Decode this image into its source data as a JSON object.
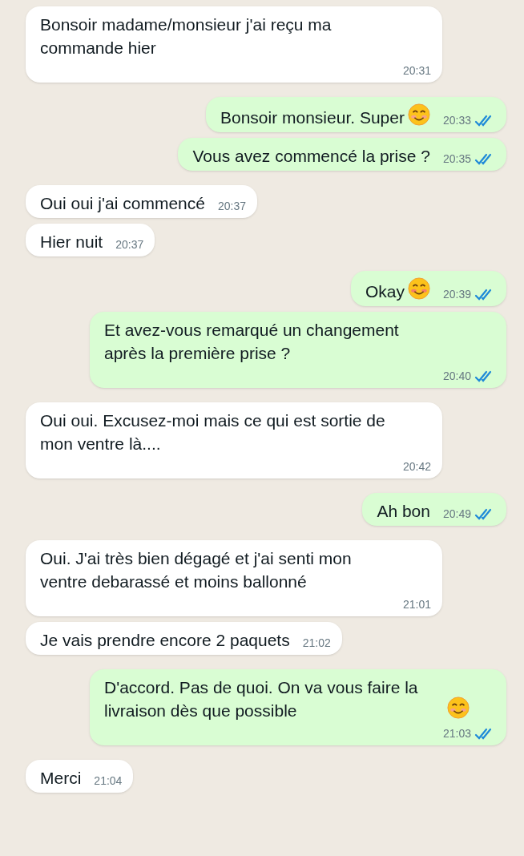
{
  "messages": [
    {
      "text": "Bonsoir madame/monsieur j'ai reçu ma commande hier",
      "time": "20:31",
      "outgoing": false
    },
    {
      "text": "Bonsoir monsieur. Super",
      "emoji": {
        "kind": "smiling"
      },
      "time": "20:33",
      "outgoing": true,
      "read": true
    },
    {
      "text": "Vous avez commencé la prise ?",
      "time": "20:35",
      "outgoing": true,
      "read": true
    },
    {
      "text": "Oui oui j'ai commencé",
      "time": "20:37",
      "outgoing": false
    },
    {
      "text": "Hier nuit",
      "time": "20:37",
      "outgoing": false
    },
    {
      "text": "Okay",
      "emoji": {
        "kind": "blushing"
      },
      "time": "20:39",
      "outgoing": true,
      "read": true
    },
    {
      "text": "Et avez-vous remarqué un changement après la première prise ?",
      "time": "20:40",
      "outgoing": true,
      "read": true
    },
    {
      "text": "Oui oui. Excusez-moi mais ce qui est sortie de mon ventre là....",
      "time": "20:42",
      "outgoing": false
    },
    {
      "text": "Ah bon",
      "time": "20:49",
      "outgoing": true,
      "read": true
    },
    {
      "text": "Oui. J'ai très bien dégagé et j'ai senti mon ventre debarassé et moins ballonné",
      "time": "21:01",
      "outgoing": false
    },
    {
      "text": "Je vais prendre encore 2 paquets",
      "time": "21:02",
      "outgoing": false
    },
    {
      "text": "D'accord. Pas de quoi. On va vous faire la livraison dès que possible",
      "emoji": {
        "kind": "smiling"
      },
      "time": "21:03",
      "outgoing": true,
      "read": true
    },
    {
      "text": "Merci",
      "time": "21:04",
      "outgoing": false
    }
  ]
}
